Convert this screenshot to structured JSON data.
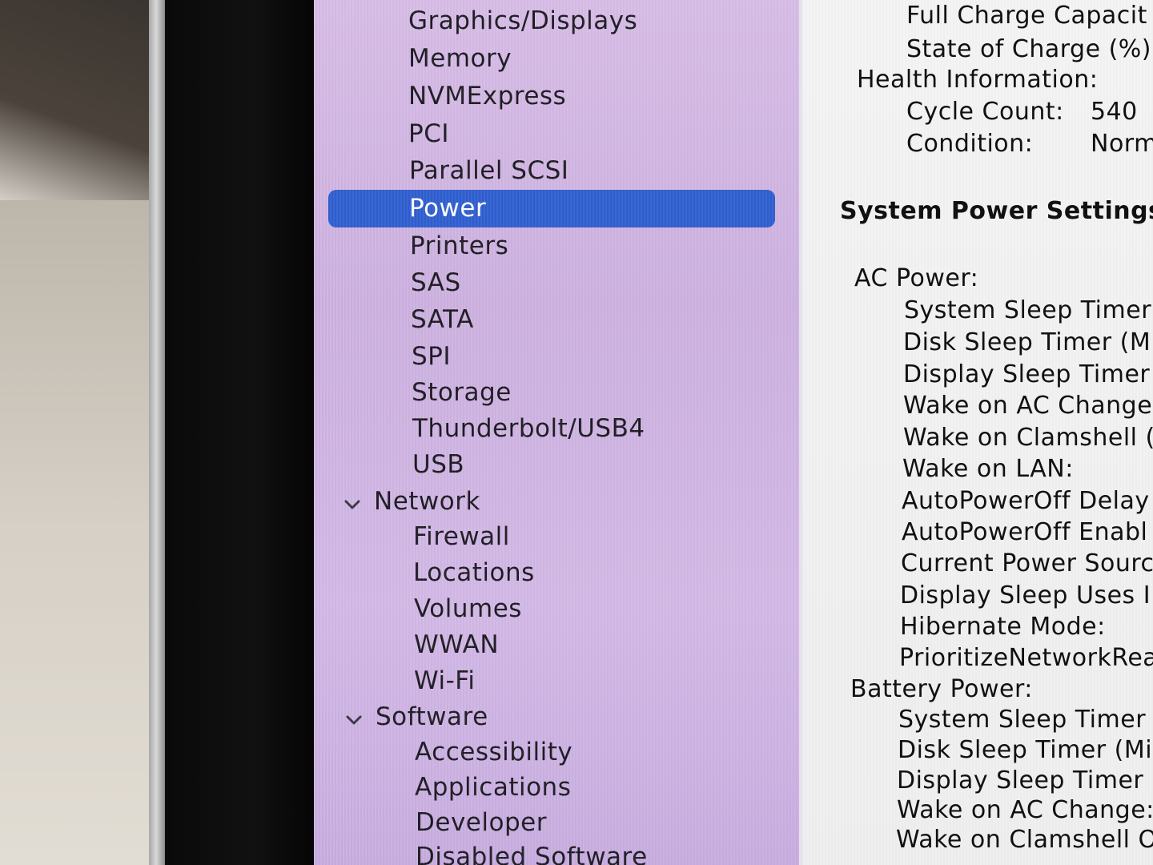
{
  "sidebar": {
    "items": [
      {
        "label": "Graphics/Displays"
      },
      {
        "label": "Memory"
      },
      {
        "label": "NVMExpress"
      },
      {
        "label": "PCI"
      },
      {
        "label": "Parallel SCSI"
      },
      {
        "label": "Power",
        "selected": true
      },
      {
        "label": "Printers"
      },
      {
        "label": "SAS"
      },
      {
        "label": "SATA"
      },
      {
        "label": "SPI"
      },
      {
        "label": "Storage"
      },
      {
        "label": "Thunderbolt/USB4"
      },
      {
        "label": "USB"
      }
    ],
    "network": {
      "label": "Network",
      "icon": "chevron-down-icon",
      "items": [
        {
          "label": "Firewall"
        },
        {
          "label": "Locations"
        },
        {
          "label": "Volumes"
        },
        {
          "label": "WWAN"
        },
        {
          "label": "Wi-Fi"
        }
      ]
    },
    "software": {
      "label": "Software",
      "icon": "chevron-down-icon",
      "items": [
        {
          "label": "Accessibility"
        },
        {
          "label": "Applications"
        },
        {
          "label": "Developer"
        },
        {
          "label": "Disabled Software"
        }
      ]
    },
    "selection_color": "#2f5fd0"
  },
  "content": {
    "full_charge_label": "Full Charge Capacit",
    "state_of_charge_label": "State of Charge (%)",
    "health_header": "Health Information:",
    "cycle_count_label": "Cycle Count:",
    "cycle_count_value": "540",
    "condition_label": "Condition:",
    "condition_value": "Norm",
    "section_title": "System Power Settings",
    "ac_header": "AC Power:",
    "ac_items": [
      "System Sleep Timer",
      "Disk Sleep Timer (M",
      "Display Sleep Timer",
      "Wake on AC Change",
      "Wake on Clamshell (",
      "Wake on LAN:",
      "AutoPowerOff Delay",
      "AutoPowerOff Enabl",
      "Current Power Sourc",
      "Display Sleep Uses I",
      "Hibernate Mode:",
      "PrioritizeNetworkRea"
    ],
    "battery_header": "Battery Power:",
    "battery_items": [
      "System Sleep Timer",
      "Disk Sleep Timer (Mi",
      "Display Sleep Timer (",
      "Wake on AC Change:",
      "Wake on Clamshell O"
    ]
  }
}
